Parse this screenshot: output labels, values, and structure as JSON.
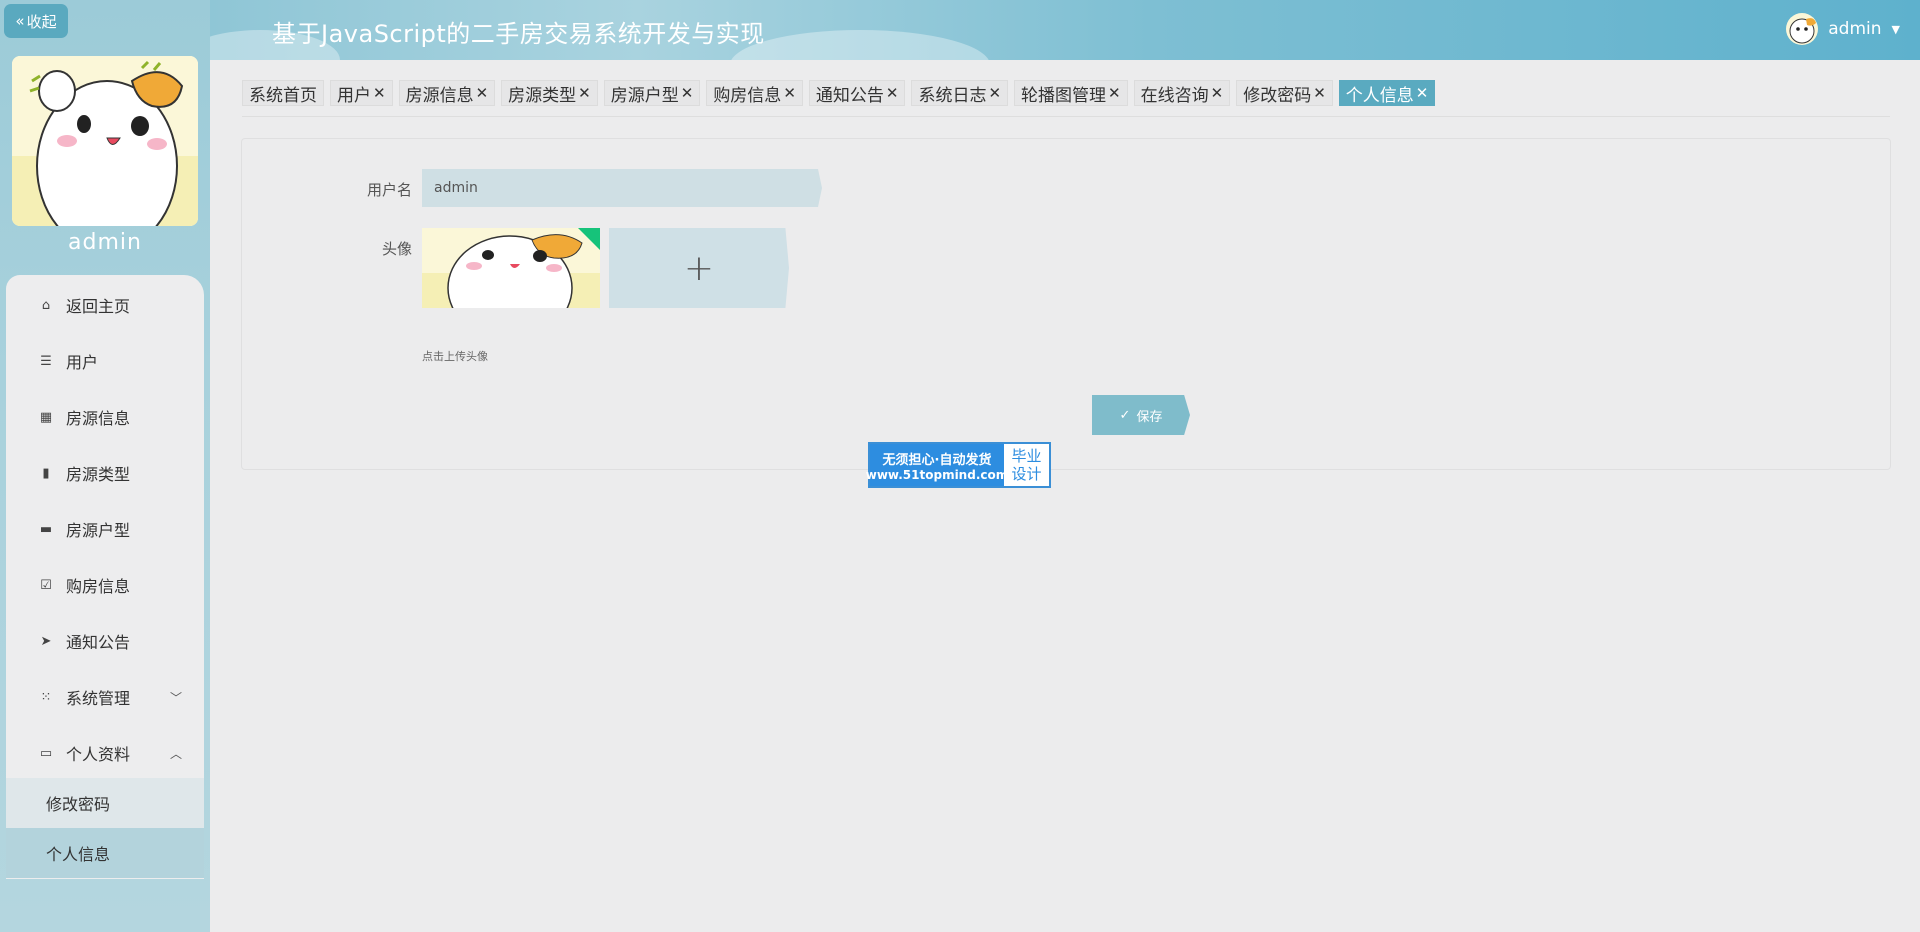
{
  "app": {
    "title": "基于JavaScript的二手房交易系统开发与实现",
    "collapse_label": "收起"
  },
  "user": {
    "name": "admin"
  },
  "sidebar": {
    "user_name": "admin",
    "items": [
      {
        "label": "返回主页",
        "icon": "home-icon"
      },
      {
        "label": "用户",
        "icon": "list-icon"
      },
      {
        "label": "房源信息",
        "icon": "grid-icon"
      },
      {
        "label": "房源类型",
        "icon": "clipboard-icon"
      },
      {
        "label": "房源户型",
        "icon": "printer-icon"
      },
      {
        "label": "购房信息",
        "icon": "clipboard-check-icon"
      },
      {
        "label": "通知公告",
        "icon": "send-icon"
      },
      {
        "label": "系统管理",
        "icon": "apps-icon"
      },
      {
        "label": "个人资料",
        "icon": "wallet-icon"
      }
    ],
    "sub_items": [
      {
        "label": "修改密码"
      },
      {
        "label": "个人信息"
      }
    ]
  },
  "tabs": [
    {
      "label": "系统首页",
      "closable": false
    },
    {
      "label": "用户",
      "closable": true
    },
    {
      "label": "房源信息",
      "closable": true
    },
    {
      "label": "房源类型",
      "closable": true
    },
    {
      "label": "房源户型",
      "closable": true
    },
    {
      "label": "购房信息",
      "closable": true
    },
    {
      "label": "通知公告",
      "closable": true
    },
    {
      "label": "系统日志",
      "closable": true
    },
    {
      "label": "轮播图管理",
      "closable": true
    },
    {
      "label": "在线咨询",
      "closable": true
    },
    {
      "label": "修改密码",
      "closable": true
    },
    {
      "label": "个人信息",
      "closable": true,
      "active": true
    }
  ],
  "form": {
    "username_label": "用户名",
    "username_value": "admin",
    "avatar_label": "头像",
    "upload_hint": "点击上传头像",
    "save_label": "保存"
  },
  "watermark": {
    "line1": "无须担心·自动发货",
    "line2": "www.51topmind.com",
    "right1": "毕业",
    "right2": "设计"
  },
  "colors": {
    "accent": "#5aaac0",
    "sidebar_bg": "#a8d1dc",
    "page_bg": "#ececed"
  }
}
